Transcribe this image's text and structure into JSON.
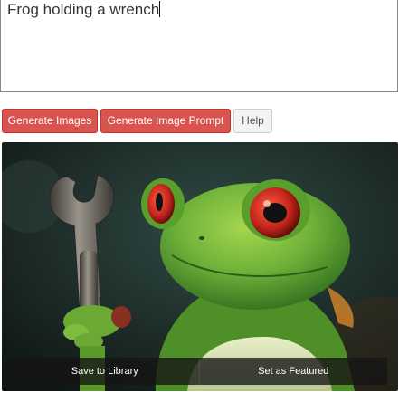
{
  "prompt": {
    "value": "Frog holding a wrench"
  },
  "buttons": {
    "generate_images": "Generate Images",
    "generate_prompt": "Generate Image Prompt",
    "help": "Help"
  },
  "image": {
    "actions": {
      "save": "Save to Library",
      "feature": "Set as Featured"
    }
  },
  "colors": {
    "primary_red": "#d9534f",
    "frog_green": "#6fb23a",
    "eye_red": "#c0231a"
  }
}
